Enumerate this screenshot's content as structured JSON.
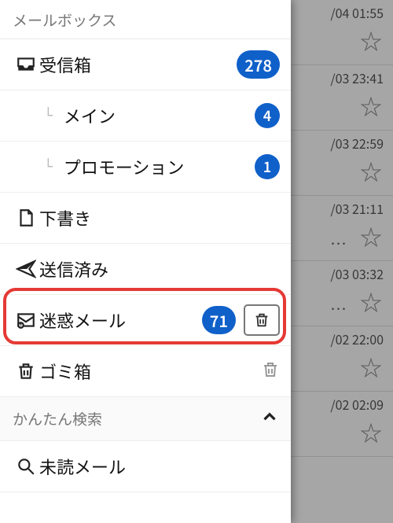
{
  "sections": {
    "mailbox_title": "メールボックス",
    "search_title": "かんたん検索"
  },
  "folders": {
    "inbox": {
      "label": "受信箱",
      "count": "278"
    },
    "main": {
      "label": "メイン",
      "count": "4"
    },
    "promo": {
      "label": "プロモーション",
      "count": "1"
    },
    "drafts": {
      "label": "下書き"
    },
    "sent": {
      "label": "送信済み"
    },
    "spam": {
      "label": "迷惑メール",
      "count": "71"
    },
    "trash": {
      "label": "ゴミ箱"
    }
  },
  "search": {
    "unread": {
      "label": "未読メール"
    }
  },
  "bg_items": [
    {
      "time": "/04 01:55"
    },
    {
      "time": "/03 23:41"
    },
    {
      "time": "/03 22:59"
    },
    {
      "time": "/03 21:11"
    },
    {
      "time": "/03 03:32"
    },
    {
      "time": "/02 22:00"
    },
    {
      "time": "/02 02:09"
    }
  ],
  "highlight_target": "spam"
}
